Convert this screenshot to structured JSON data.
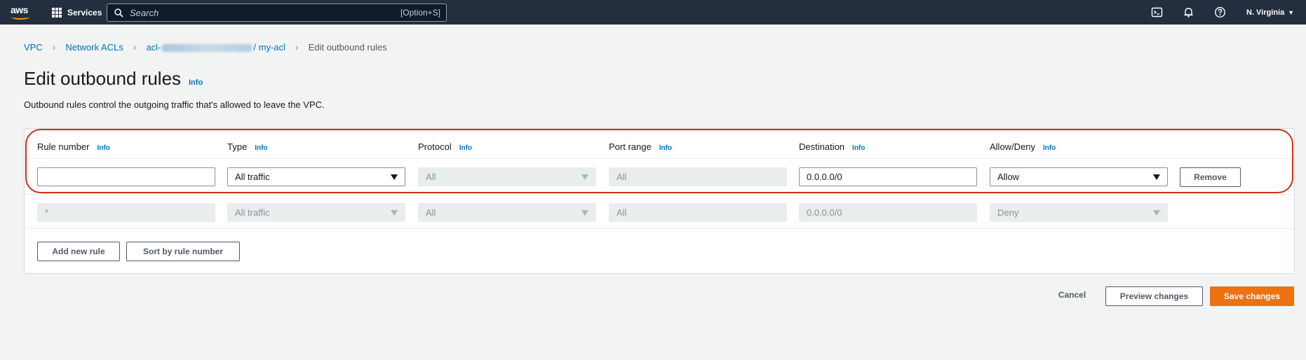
{
  "topnav": {
    "logo": "aws",
    "services_label": "Services",
    "search_placeholder": "Search",
    "search_shortcut": "[Option+S]",
    "region": "N. Virginia",
    "icons": [
      "cloudshell-icon",
      "bell-icon",
      "help-icon"
    ]
  },
  "breadcrumb": {
    "items": [
      "VPC",
      "Network ACLs"
    ],
    "acl_prefix": "acl-",
    "acl_suffix": "/ my-acl",
    "current": "Edit outbound rules"
  },
  "page": {
    "title": "Edit outbound rules",
    "title_info": "Info",
    "description": "Outbound rules control the outgoing traffic that's allowed to leave the VPC."
  },
  "table": {
    "headers": [
      {
        "label": "Rule number",
        "info": "Info"
      },
      {
        "label": "Type",
        "info": "Info"
      },
      {
        "label": "Protocol",
        "info": "Info"
      },
      {
        "label": "Port range",
        "info": "Info"
      },
      {
        "label": "Destination",
        "info": "Info"
      },
      {
        "label": "Allow/Deny",
        "info": "Info"
      }
    ],
    "editable_row": {
      "rule_number": "",
      "type": "All traffic",
      "protocol": "All",
      "port_range": "All",
      "destination": "0.0.0.0/0",
      "allow_deny": "Allow",
      "remove_label": "Remove"
    },
    "default_row": {
      "rule_number": "*",
      "type": "All traffic",
      "protocol": "All",
      "port_range": "All",
      "destination": "0.0.0.0/0",
      "allow_deny": "Deny"
    },
    "add_rule_label": "Add new rule",
    "sort_label": "Sort by rule number"
  },
  "footer": {
    "cancel_label": "Cancel",
    "preview_label": "Preview changes",
    "save_label": "Save changes"
  },
  "colors": {
    "nav_bg": "#232f3e",
    "link": "#0073bb",
    "primary": "#ec7211",
    "highlight": "#d13212"
  }
}
